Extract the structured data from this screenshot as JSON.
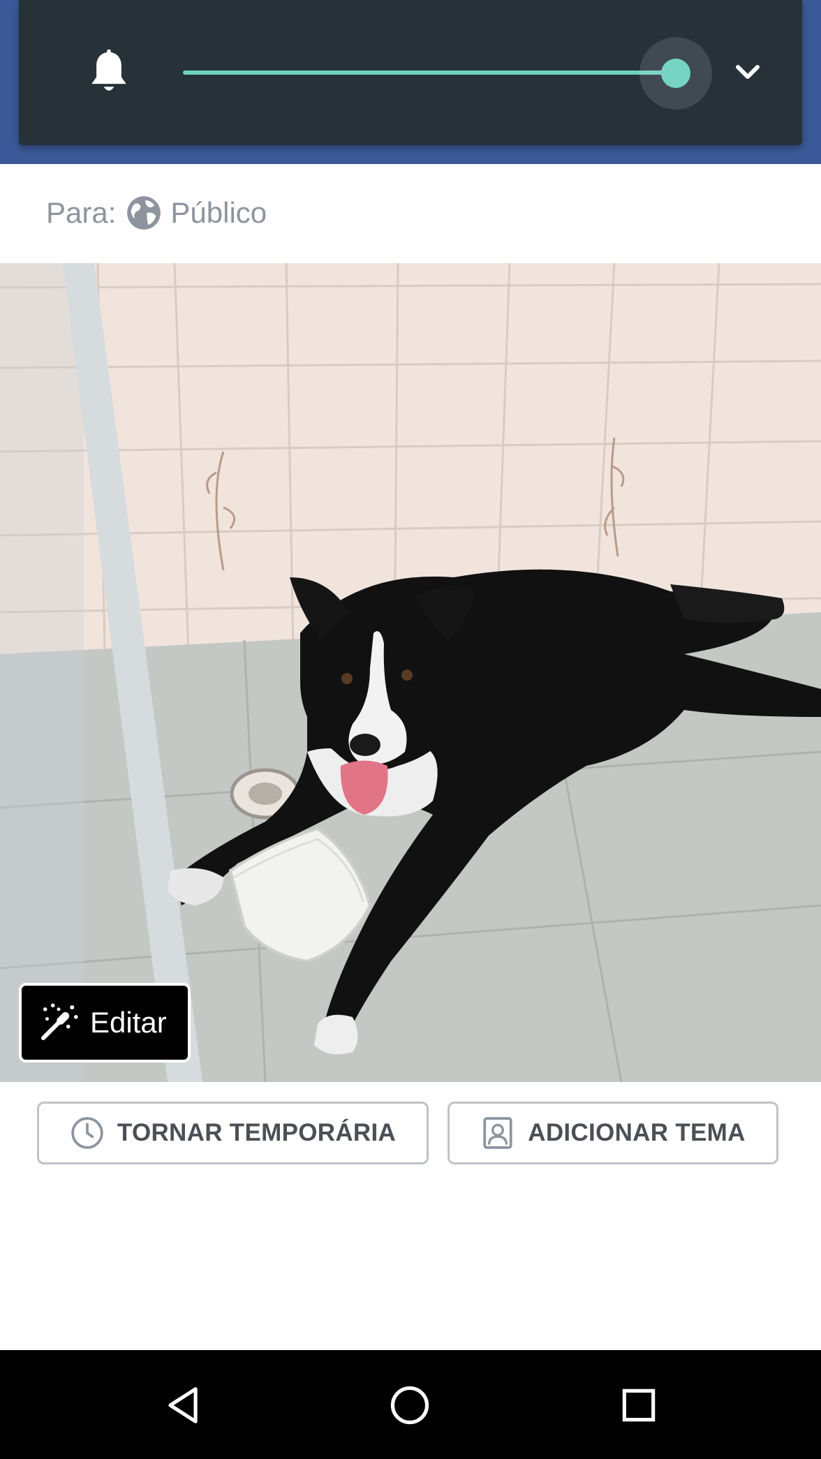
{
  "volume_panel": {
    "icon": "bell-icon",
    "level_fraction": 1.0,
    "expand_icon": "chevron-down-icon",
    "accent_color": "#76d4c4"
  },
  "audience": {
    "prefix": "Para:",
    "icon": "globe-icon",
    "value": "Público"
  },
  "photo": {
    "edit_label": "Editar",
    "edit_icon": "magic-wand-icon"
  },
  "actions": {
    "make_temporary": {
      "label": "TORNAR TEMPORÁRIA",
      "icon": "clock-icon"
    },
    "add_theme": {
      "label": "ADICIONAR TEMA",
      "icon": "profile-frame-icon"
    }
  },
  "navigation": {
    "back": "back-icon",
    "home": "home-icon",
    "recents": "recents-icon"
  }
}
